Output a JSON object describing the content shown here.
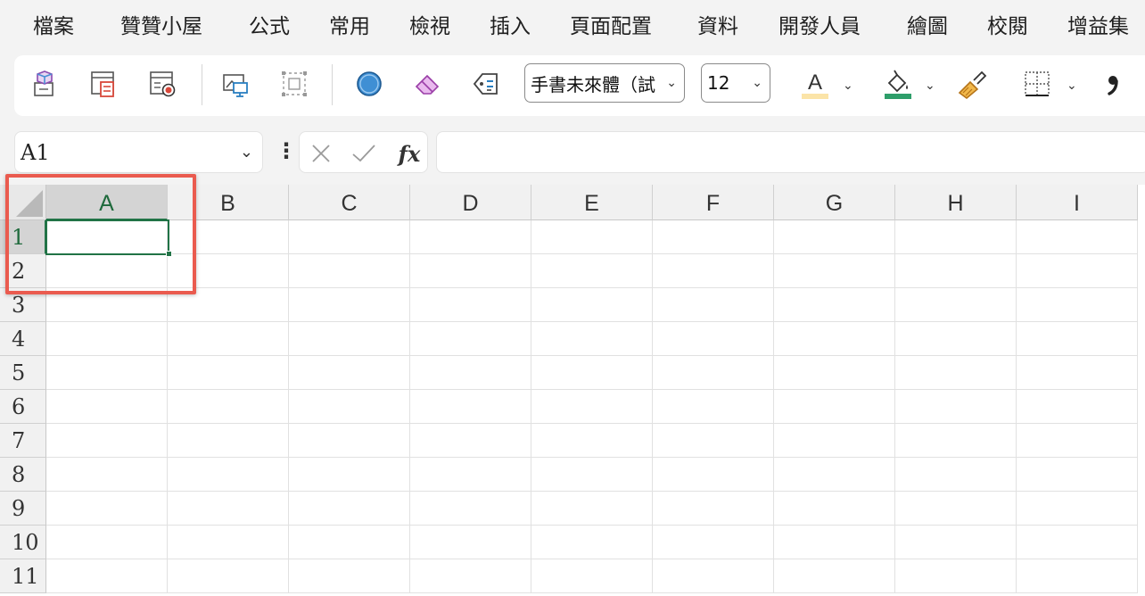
{
  "menu": {
    "items": [
      "檔案",
      "贊贊小屋",
      "公式",
      "常用",
      "檢視",
      "插入",
      "頁面配置",
      "資料",
      "開發人員",
      "繪圖",
      "校閱",
      "增益集"
    ]
  },
  "ribbon": {
    "font_name": "手書未來體（試",
    "font_size": "12",
    "icons": [
      "3d-model-icon",
      "sheet-form-icon",
      "record-macro-icon",
      "picture-icon",
      "select-objects-icon",
      "circle-shape-icon",
      "eraser-icon",
      "tag-icon",
      "font-color-icon",
      "fill-color-icon",
      "format-painter-icon",
      "borders-icon",
      "comma-style-icon"
    ],
    "colors": {
      "accent_green": "#217346",
      "font_color_bar": "#fbe4a8",
      "fill_color_bar": "#2e9e6a",
      "highlight": "#ea5b4f"
    }
  },
  "formula_bar": {
    "name_box": "A1",
    "fx_label": "fx",
    "formula": ""
  },
  "sheet": {
    "columns": [
      "A",
      "B",
      "C",
      "D",
      "E",
      "F",
      "G",
      "H",
      "I"
    ],
    "rows": [
      "1",
      "2",
      "3",
      "4",
      "5",
      "6",
      "7",
      "8",
      "9",
      "10",
      "11"
    ],
    "active_cell": "A1",
    "selected_column": "A",
    "selected_row": "1"
  }
}
